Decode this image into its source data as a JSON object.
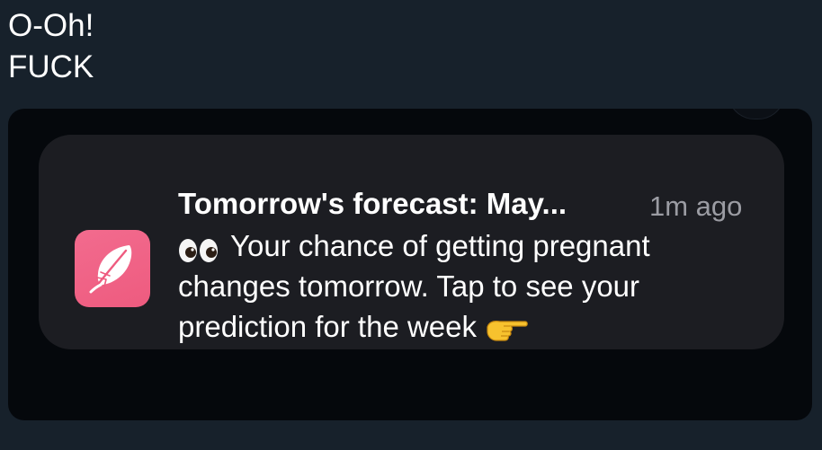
{
  "message": {
    "caption_lines": [
      "O-Oh!",
      "FUCK"
    ]
  },
  "notification": {
    "app_icon": "feather-icon",
    "title": "Tomorrow's forecast: May...",
    "time": "1m ago",
    "body_lines": [
      "Your chance of getting pregnant",
      "changes tomorrow. Tap to see your",
      "prediction for the week"
    ],
    "leading_emoji": "eyes-emoji",
    "trailing_emoji": "pointing-right-emoji"
  },
  "colors": {
    "chat_background": "#17212b",
    "photo_background": "#05080c",
    "notification_background": "#1c1d22",
    "app_icon": "#ee5b7f",
    "time_text": "#9b9ca3"
  }
}
